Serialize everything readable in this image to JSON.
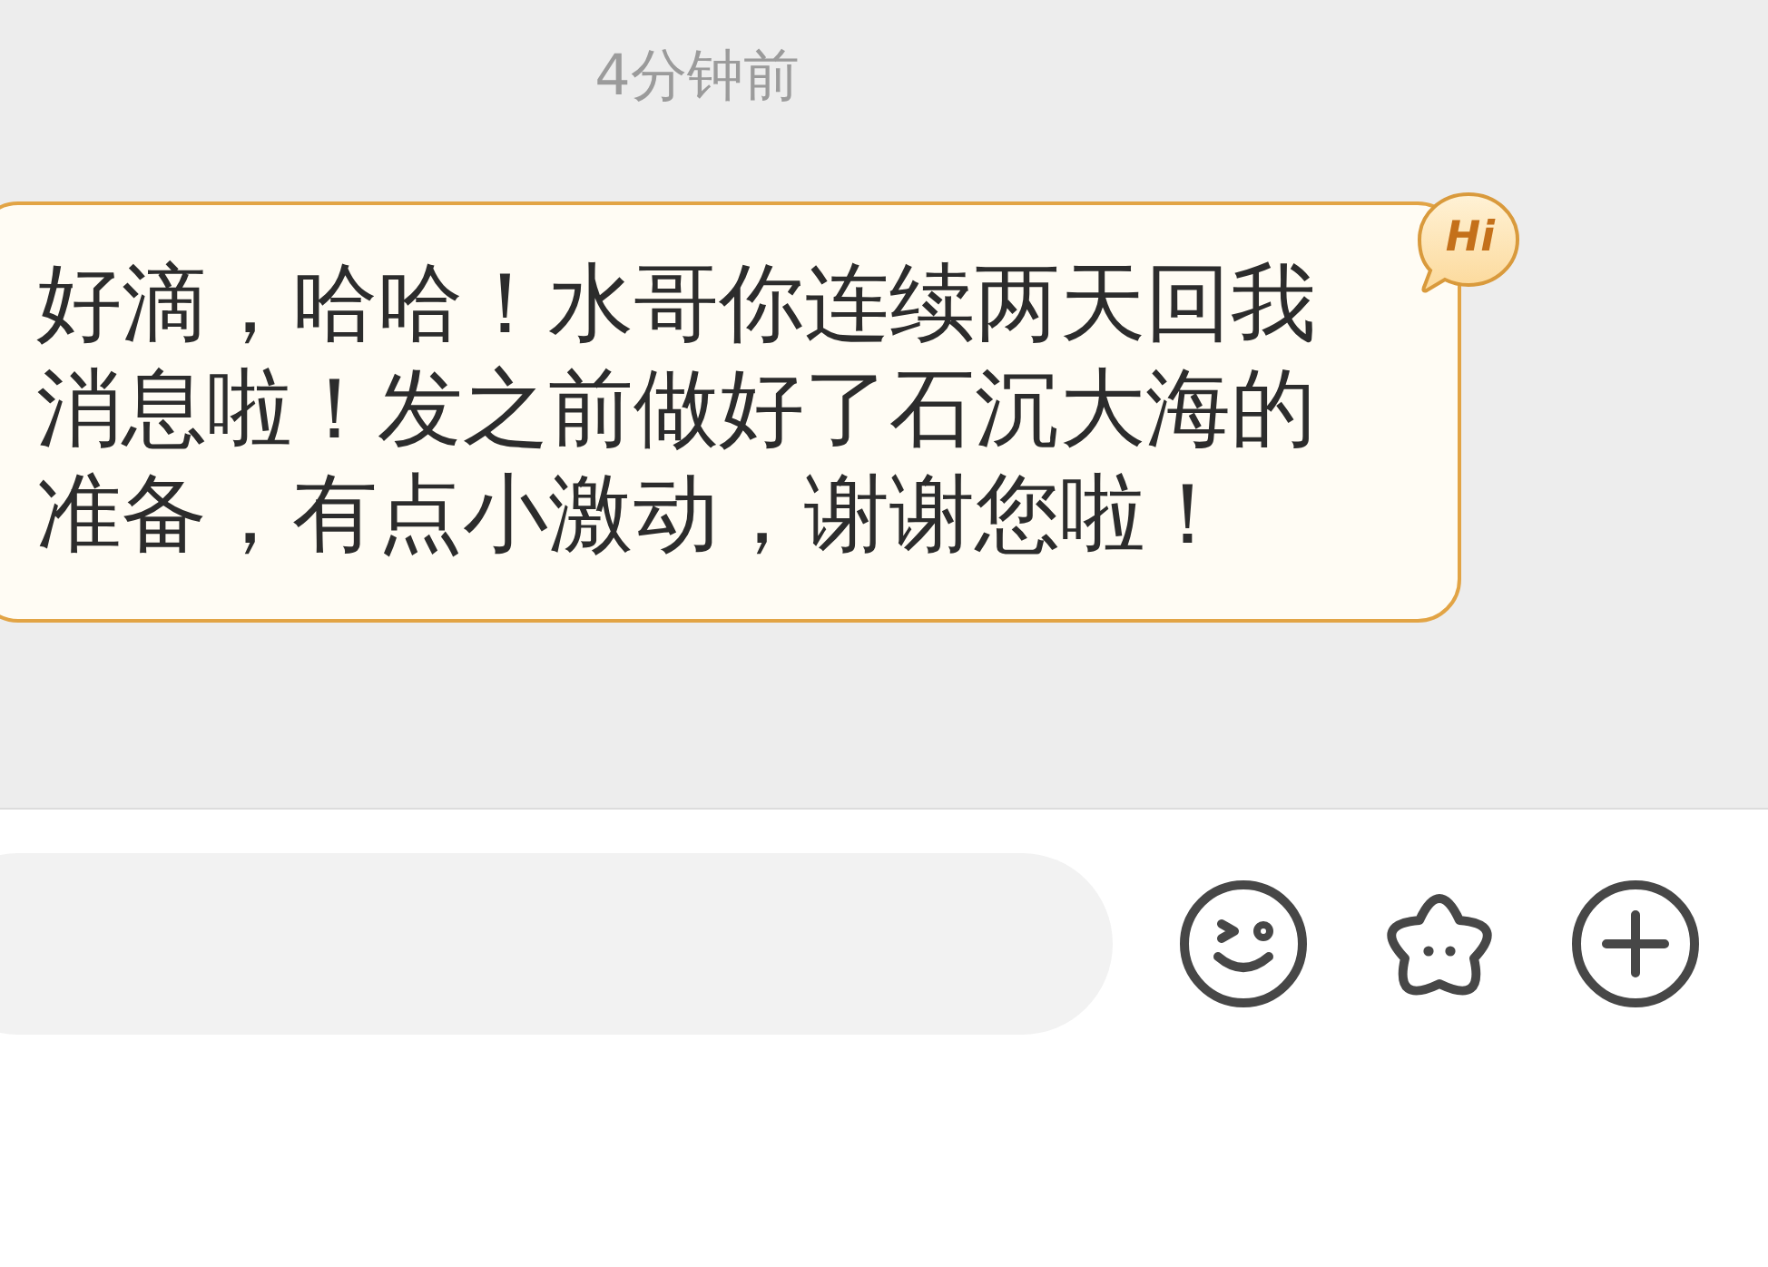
{
  "timestamp": "4分钟前",
  "message": {
    "text": "好滴，哈哈！水哥你连续两天回我消息啦！发之前做好了石沉大海的准备，有点小激动，谢谢您啦！",
    "sticker": "Hi"
  }
}
